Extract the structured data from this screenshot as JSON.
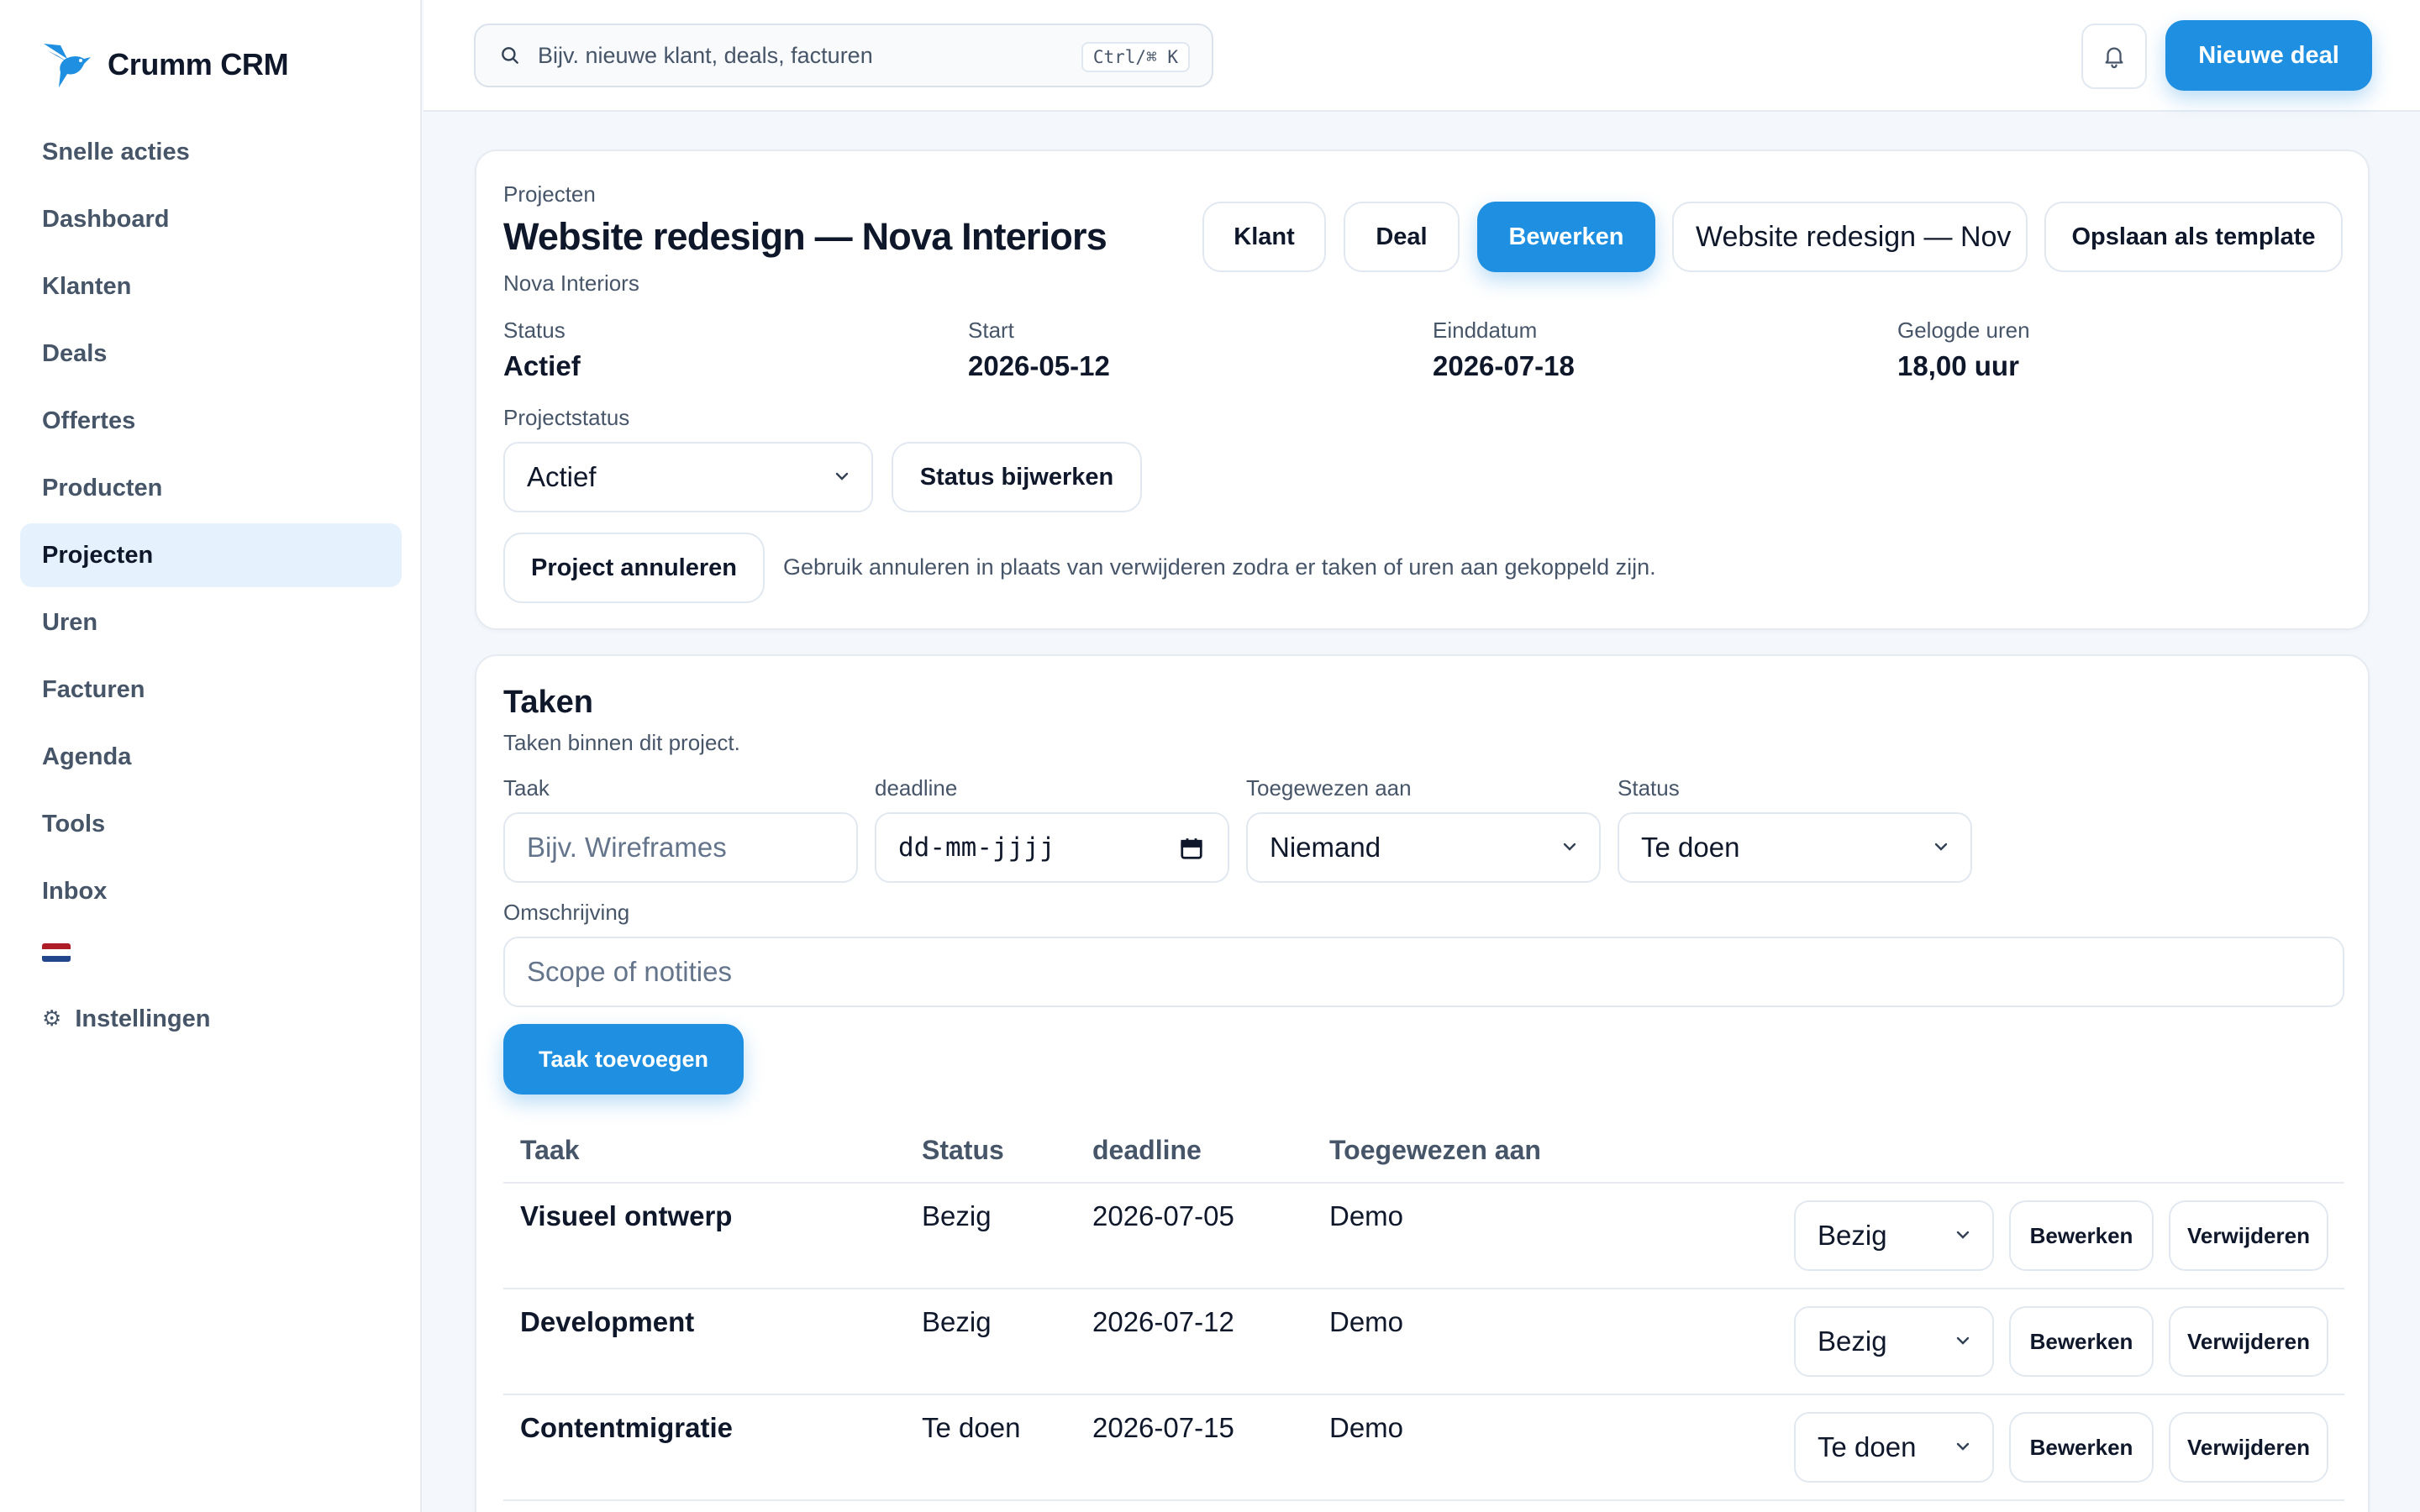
{
  "brand": {
    "name": "Crumm CRM",
    "accent": "#1e8fe1"
  },
  "sidebar": {
    "items": [
      {
        "label": "Snelle acties",
        "active": false
      },
      {
        "label": "Dashboard",
        "active": false
      },
      {
        "label": "Klanten",
        "active": false
      },
      {
        "label": "Deals",
        "active": false
      },
      {
        "label": "Offertes",
        "active": false
      },
      {
        "label": "Producten",
        "active": false
      },
      {
        "label": "Projecten",
        "active": true
      },
      {
        "label": "Uren",
        "active": false
      },
      {
        "label": "Facturen",
        "active": false
      },
      {
        "label": "Agenda",
        "active": false
      },
      {
        "label": "Tools",
        "active": false
      },
      {
        "label": "Inbox",
        "active": false
      }
    ],
    "language_flag": "flag-nl-icon",
    "settings_label": "Instellingen",
    "settings_icon": "⚙"
  },
  "topbar": {
    "search_placeholder": "Bijv. nieuwe klant, deals, facturen",
    "shortcut": "Ctrl/⌘ K",
    "bell_icon": "bell-icon",
    "new_deal_label": "Nieuwe deal"
  },
  "project": {
    "breadcrumb": "Projecten",
    "title": "Website redesign — Nova Interiors",
    "client": "Nova Interiors",
    "buttons": {
      "klant": "Klant",
      "deal": "Deal",
      "bewerken": "Bewerken",
      "title_field": "Website redesign — Nov",
      "save_template": "Opslaan als template"
    },
    "meta": [
      {
        "label": "Status",
        "value": "Actief"
      },
      {
        "label": "Start",
        "value": "2026-05-12"
      },
      {
        "label": "Einddatum",
        "value": "2026-07-18"
      },
      {
        "label": "Gelogde uren",
        "value": "18,00 uur"
      }
    ],
    "status_label": "Projectstatus",
    "status_value": "Actief",
    "update_status_label": "Status bijwerken",
    "cancel_label": "Project annuleren",
    "cancel_hint": "Gebruik annuleren in plaats van verwijderen zodra er taken of uren aan gekoppeld zijn."
  },
  "tasks": {
    "title": "Taken",
    "subtitle": "Taken binnen dit project.",
    "form": {
      "task_label": "Taak",
      "task_placeholder": "Bijv. Wireframes",
      "deadline_label": "deadline",
      "deadline_placeholder": "dd-mm-jjjj",
      "assignee_label": "Toegewezen aan",
      "assignee_value": "Niemand",
      "status_label": "Status",
      "status_value": "Te doen",
      "description_label": "Omschrijving",
      "description_placeholder": "Scope of notities",
      "add_label": "Taak toevoegen"
    },
    "columns": [
      "Taak",
      "Status",
      "deadline",
      "Toegewezen aan"
    ],
    "rows": [
      {
        "name": "Visueel ontwerp",
        "status": "Bezig",
        "deadline": "2026-07-05",
        "assignee": "Demo",
        "select": "Bezig"
      },
      {
        "name": "Development",
        "status": "Bezig",
        "deadline": "2026-07-12",
        "assignee": "Demo",
        "select": "Bezig"
      },
      {
        "name": "Contentmigratie",
        "status": "Te doen",
        "deadline": "2026-07-15",
        "assignee": "Demo",
        "select": "Te doen"
      }
    ],
    "row_edit_label": "Bewerken",
    "row_delete_label": "Verwijderen"
  }
}
